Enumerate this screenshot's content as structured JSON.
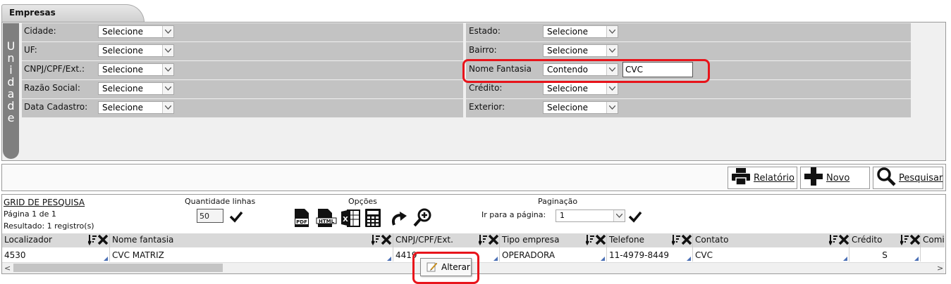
{
  "tab": {
    "title": "Empresas"
  },
  "unidade_label": [
    "U",
    "n",
    "i",
    "d",
    "a",
    "d",
    "e"
  ],
  "filters": {
    "left": [
      {
        "label": "Cidade:",
        "value": "Selecione"
      },
      {
        "label": "UF:",
        "value": "Selecione"
      },
      {
        "label": "CNPJ/CPF/Ext.:",
        "value": "Selecione"
      },
      {
        "label": "Razão Social:",
        "value": "Selecione"
      },
      {
        "label": "Data Cadastro:",
        "value": "Selecione"
      }
    ],
    "right": [
      {
        "label": "Estado:",
        "value": "Selecione"
      },
      {
        "label": "Bairro:",
        "value": "Selecione"
      },
      {
        "label": "Nome Fantasia",
        "value": "Contendo",
        "text_value": "CVC"
      },
      {
        "label": "Crédito:",
        "value": "Selecione"
      },
      {
        "label": "Exterior:",
        "value": "Selecione"
      }
    ]
  },
  "actions": {
    "relatorio": "Relatório",
    "novo": "Novo",
    "pesquisar": "Pesquisar"
  },
  "grid": {
    "title": "GRID DE PESQUISA",
    "page_info": "Página 1 de 1",
    "result_info": "Resultado: 1 registro(s)",
    "qty_label": "Quantidade linhas",
    "qty_value": "50",
    "options_label": "Opções",
    "pagination_label": "Paginação",
    "goto_label": "Ir para a página:",
    "goto_value": "1",
    "columns": [
      "Localizador",
      "Nome fantasia",
      "CNPJ/CPF/Ext.",
      "Tipo empresa",
      "Telefone",
      "Contato",
      "Crédito",
      "Comi"
    ],
    "row": [
      "4530",
      "CVC MATRIZ",
      "4419",
      "OPERADORA",
      "11-4979-8449",
      "CVC",
      "S",
      ""
    ],
    "sort_clear_icon": "sort-clear-icon"
  },
  "context_menu": {
    "alterar": "Alterar"
  },
  "colors": {
    "highlight": "#e8141b",
    "row_bg": "#c3c3c3",
    "unidade_bg": "#7f7f7f"
  }
}
